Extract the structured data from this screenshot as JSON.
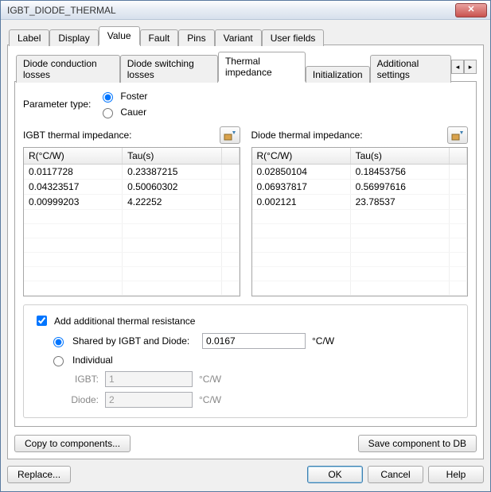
{
  "window": {
    "title": "IGBT_DIODE_THERMAL"
  },
  "tabs": {
    "items": [
      "Label",
      "Display",
      "Value",
      "Fault",
      "Pins",
      "Variant",
      "User fields"
    ],
    "active": 2
  },
  "subtabs": {
    "items": [
      "Diode conduction losses",
      "Diode switching losses",
      "Thermal impedance",
      "Initialization",
      "Additional settings"
    ],
    "active": 2
  },
  "param_type": {
    "label": "Parameter type:",
    "options": {
      "foster": "Foster",
      "cauer": "Cauer"
    },
    "selected": "foster"
  },
  "tables": {
    "igbt": {
      "label": "IGBT thermal impedance:",
      "headers": [
        "R(°C/W)",
        "Tau(s)"
      ],
      "rows": [
        [
          "0.0117728",
          "0.23387215"
        ],
        [
          "0.04323517",
          "0.50060302"
        ],
        [
          "0.00999203",
          "4.22252"
        ]
      ]
    },
    "diode": {
      "label": "Diode thermal impedance:",
      "headers": [
        "R(°C/W)",
        "Tau(s)"
      ],
      "rows": [
        [
          "0.02850104",
          "0.18453756"
        ],
        [
          "0.06937817",
          "0.56997616"
        ],
        [
          "0.002121",
          "23.78537"
        ]
      ]
    }
  },
  "additional": {
    "checkbox_label": "Add additional thermal resistance",
    "checkbox_checked": true,
    "mode": "shared",
    "shared_label": "Shared by IGBT and Diode:",
    "shared_value": "0.0167",
    "unit": "°C/W",
    "individual_label": "Individual",
    "igbt_label": "IGBT:",
    "igbt_value": "1",
    "diode_label": "Diode:",
    "diode_value": "2"
  },
  "buttons": {
    "copy": "Copy to components...",
    "save_db": "Save component to DB",
    "replace": "Replace...",
    "ok": "OK",
    "cancel": "Cancel",
    "help": "Help"
  }
}
